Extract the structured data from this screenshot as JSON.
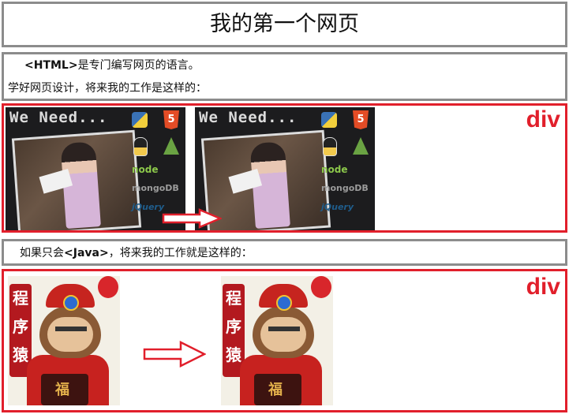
{
  "title": "我的第一个网页",
  "intro": {
    "line1_tag": "<HTML>",
    "line1_rest": "是专门编写网页的语言。",
    "line2": "学好网页设计，将来我的工作是这样的："
  },
  "java": {
    "prefix": "如果只会",
    "tag": "<Java>",
    "rest": "，将来我的工作就是这样的："
  },
  "div_label": "div",
  "web_image": {
    "heading": "We Need...",
    "logo_node": "node",
    "logo_mongo": "mongoDB",
    "logo_jq": "jQuery"
  },
  "monkey_image": {
    "banner": [
      "程",
      "序",
      "猿"
    ]
  },
  "colors": {
    "accent": "#e11f2b",
    "border_gray": "#8c8c8c"
  }
}
